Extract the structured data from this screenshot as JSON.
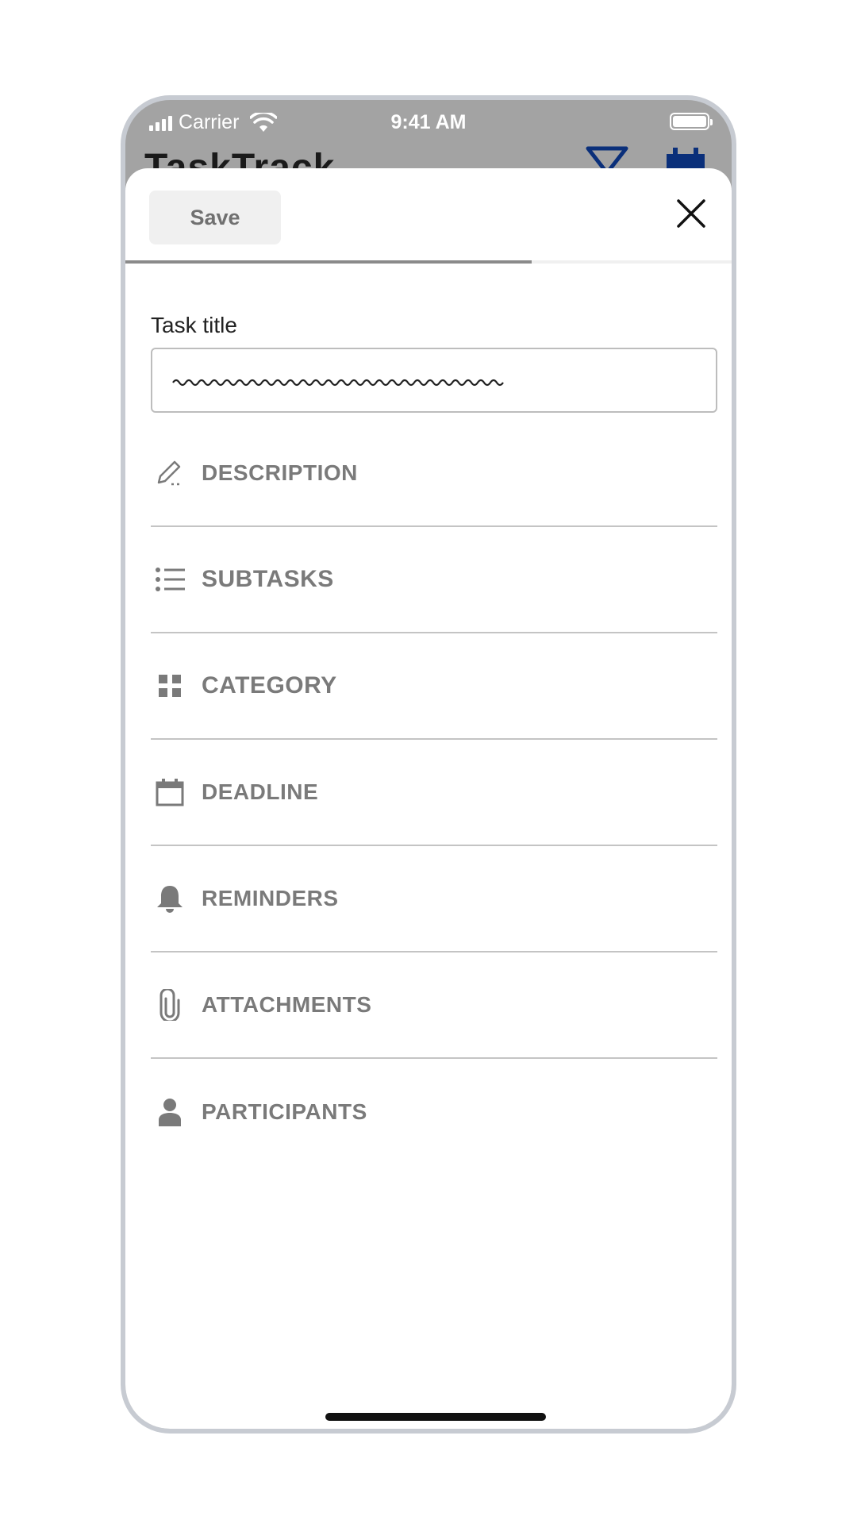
{
  "status_bar": {
    "carrier": "Carrier",
    "time": "9:41 AM"
  },
  "background_app": {
    "title": "TaskTrack",
    "accent_color": "#0a2f7a",
    "icons": [
      "filter-icon",
      "calendar-icon"
    ]
  },
  "sheet": {
    "save_label": "Save",
    "close_icon": "close-icon",
    "progress_percent": 67,
    "title_field": {
      "label": "Task title",
      "value": ""
    },
    "items": [
      {
        "label": "DESCRIPTION",
        "icon": "pencil-icon"
      },
      {
        "label": "SUBTASKS",
        "icon": "list-icon"
      },
      {
        "label": "CATEGORY",
        "icon": "grid-icon"
      },
      {
        "label": "DEADLINE",
        "icon": "calendar-icon"
      },
      {
        "label": "REMINDERS",
        "icon": "bell-icon"
      },
      {
        "label": "ATTACHMENTS",
        "icon": "paperclip-icon"
      },
      {
        "label": "PARTICIPANTS",
        "icon": "person-icon"
      }
    ]
  },
  "colors": {
    "label_gray": "#7a7a7a",
    "divider": "#c4c4c4",
    "overlay": "#a3a3a3"
  }
}
